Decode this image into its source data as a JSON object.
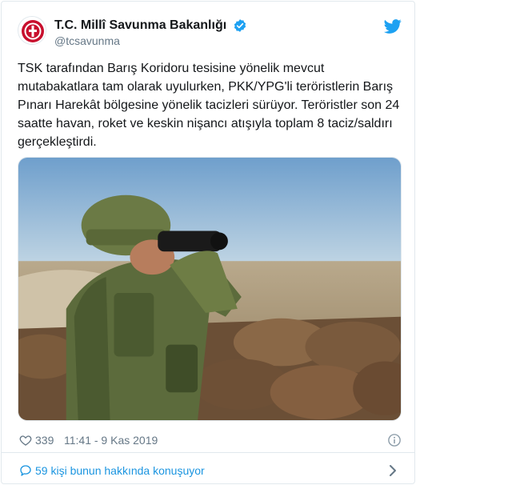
{
  "account": {
    "display_name": "T.C. Millî Savunma Bakanlığı",
    "handle": "@tcsavunma",
    "verified": true,
    "brand_color": "#1da1f2"
  },
  "tweet": {
    "text": "TSK tarafından Barış Koridoru tesisine yönelik mevcut\nmutabakatlara tam olarak uyulurken, PKK/YPG'li teröristlerin Barış\nPınarı Harekât bölgesine yönelik tacizleri sürüyor. Teröristler son 24\nsaatte havan, roket ve keskin nişancı atışıyla toplam 8 taciz/saldırı\ngerçekleştirdi."
  },
  "footer": {
    "like_count": "339",
    "timestamp": "11:41 - 9 Kas 2019",
    "conversation_label": "59 kişi bunun hakkında konuşuyor"
  },
  "icons": {
    "avatar": "ministry-emblem",
    "verified": "verified-badge-icon",
    "platform": "twitter-bird-icon",
    "like": "heart-icon",
    "info": "info-icon",
    "conversation": "speech-bubble-icon",
    "more": "chevron-right-icon"
  }
}
